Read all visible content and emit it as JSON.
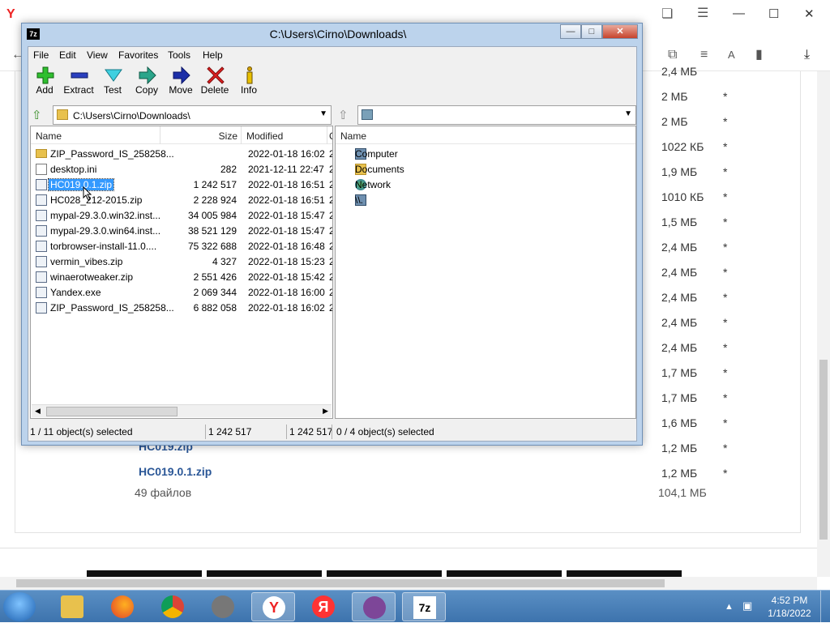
{
  "browser": {
    "downloads_icon": "download-icon",
    "page_sizes": [
      "2,4 МБ",
      "2 МБ",
      "2 МБ",
      "1022 КБ",
      "1,9 МБ",
      "1010 КБ",
      "1,5 МБ",
      "2,4 МБ",
      "2,4 МБ",
      "2,4 МБ",
      "2,4 МБ",
      "2,4 МБ",
      "1,7 МБ",
      "1,7 МБ",
      "1,6 МБ",
      "1,2 МБ",
      "1,2 МБ"
    ],
    "star": "*",
    "partial_link": "HC019.zip",
    "link": "HC019.0.1.zip",
    "files_count": "49 файлов",
    "files_total": "104,1 МБ"
  },
  "window": {
    "title": "C:\\Users\\Cirno\\Downloads\\",
    "app_icon": "7z"
  },
  "menu": [
    "File",
    "Edit",
    "View",
    "Favorites",
    "Tools",
    "Help"
  ],
  "toolbar": {
    "add": "Add",
    "extract": "Extract",
    "test": "Test",
    "copy": "Copy",
    "move": "Move",
    "delete": "Delete",
    "info": "Info"
  },
  "left_pane": {
    "address": "C:\\Users\\Cirno\\Downloads\\",
    "columns": {
      "name": "Name",
      "size": "Size",
      "modified": "Modified",
      "extra": "C"
    },
    "rows": [
      {
        "name": "ZIP_Password_IS_258258...",
        "size": "",
        "modified": "2022-01-18 16:02",
        "extra": "2",
        "type": "folder"
      },
      {
        "name": "desktop.ini",
        "size": "282",
        "modified": "2021-12-11 22:47",
        "extra": "2",
        "type": "file"
      },
      {
        "name": "HC019.0.1.zip",
        "size": "1 242 517",
        "modified": "2022-01-18 16:51",
        "extra": "2",
        "type": "zip",
        "selected": true
      },
      {
        "name": "HC028_2​12-2015.zip",
        "size": "2 228 924",
        "modified": "2022-01-18 16:51",
        "extra": "2",
        "type": "zip"
      },
      {
        "name": "mypal-29.3.0.win32.inst...",
        "size": "34 005 984",
        "modified": "2022-01-18 15:47",
        "extra": "2",
        "type": "zip"
      },
      {
        "name": "mypal-29.3.0.win64.inst...",
        "size": "38 521 129",
        "modified": "2022-01-18 15:47",
        "extra": "2",
        "type": "zip"
      },
      {
        "name": "torbrowser-install-11.0....",
        "size": "75 322 688",
        "modified": "2022-01-18 16:48",
        "extra": "2",
        "type": "zip"
      },
      {
        "name": "vermin_vibes.zip",
        "size": "4 327",
        "modified": "2022-01-18 15:23",
        "extra": "2",
        "type": "zip"
      },
      {
        "name": "winaerotweaker.zip",
        "size": "2 551 426",
        "modified": "2022-01-18 15:42",
        "extra": "2",
        "type": "zip"
      },
      {
        "name": "Yandex.exe",
        "size": "2 069 344",
        "modified": "2022-01-18 16:00",
        "extra": "2",
        "type": "zip"
      },
      {
        "name": "ZIP_Password_IS_258258...",
        "size": "6 882 058",
        "modified": "2022-01-18 16:02",
        "extra": "2",
        "type": "zip"
      }
    ]
  },
  "right_pane": {
    "columns": {
      "name": "Name"
    },
    "rows": [
      {
        "name": "Computer",
        "icon": "computer-icon"
      },
      {
        "name": "Documents",
        "icon": "documents-folder-icon"
      },
      {
        "name": "Network",
        "icon": "network-icon"
      },
      {
        "name": "\\\\.",
        "icon": "computer-icon"
      }
    ]
  },
  "status": {
    "left_selected": "1 / 11 object(s) selected",
    "size1": "1 242 517",
    "size2": "1 242 517",
    "right_selected": "0 / 4 object(s) selected"
  },
  "taskbar": {
    "time": "4:52 PM",
    "date": "1/18/2022"
  }
}
